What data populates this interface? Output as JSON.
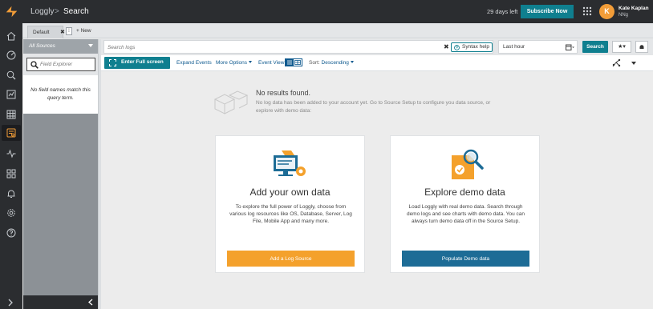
{
  "header": {
    "brand": "Loggly",
    "separator": ">",
    "page": "Search",
    "trial": "29 days left",
    "subscribe_label": "Subscribe Now",
    "user": {
      "initial": "K",
      "name": "Kate Kaplan",
      "org": "NNg"
    }
  },
  "tabs": {
    "items": [
      {
        "label": "Default",
        "close": "✖"
      }
    ],
    "menu": "⁞",
    "new_label": "+ New"
  },
  "sources": {
    "selected": "All Sources"
  },
  "field_explorer": {
    "placeholder": "Field Explorer",
    "empty_text": "No field names match this query term."
  },
  "search": {
    "placeholder": "Search logs",
    "clear": "✖",
    "syntax_help": "Syntax help",
    "time_range": "Last hour",
    "submit_label": "Search",
    "star_label": "★▾"
  },
  "toolbar": {
    "fullscreen_label": "Enter Full screen",
    "expand_events": "Expand Events",
    "more_options": "More Options",
    "event_view": "Event View",
    "sort_label": "Sort:",
    "sort_value": "Descending"
  },
  "no_results": {
    "title": "No results found.",
    "text": "No log data has been added to your account yet. Go to Source Setup to configure you data source, or explore with demo data:"
  },
  "cards": [
    {
      "title": "Add your own data",
      "text": "To explore the full power of Loggly, choose from various log resources like OS, Database, Server, Log File, Mobile App and many more.",
      "button": "Add a Log Source"
    },
    {
      "title": "Explore demo data",
      "text": "Load Loggly with real demo data. Search through demo logs and see charts with demo data. You can always turn demo data off in the Source Setup.",
      "button": "Populate Demo data"
    }
  ],
  "colors": {
    "brand_orange": "#f29d38",
    "teal": "#0f7f8f",
    "card_orange": "#f4a12c",
    "card_blue": "#1d6c96",
    "dark_chrome": "#2b2d30"
  },
  "icons": {
    "rail": [
      "home-icon",
      "dashboard-icon",
      "search-history-icon",
      "charts-icon",
      "grid-icon",
      "search-active-icon",
      "pulse-icon",
      "widgets-icon",
      "alerts-icon",
      "settings-icon",
      "help-icon"
    ]
  }
}
